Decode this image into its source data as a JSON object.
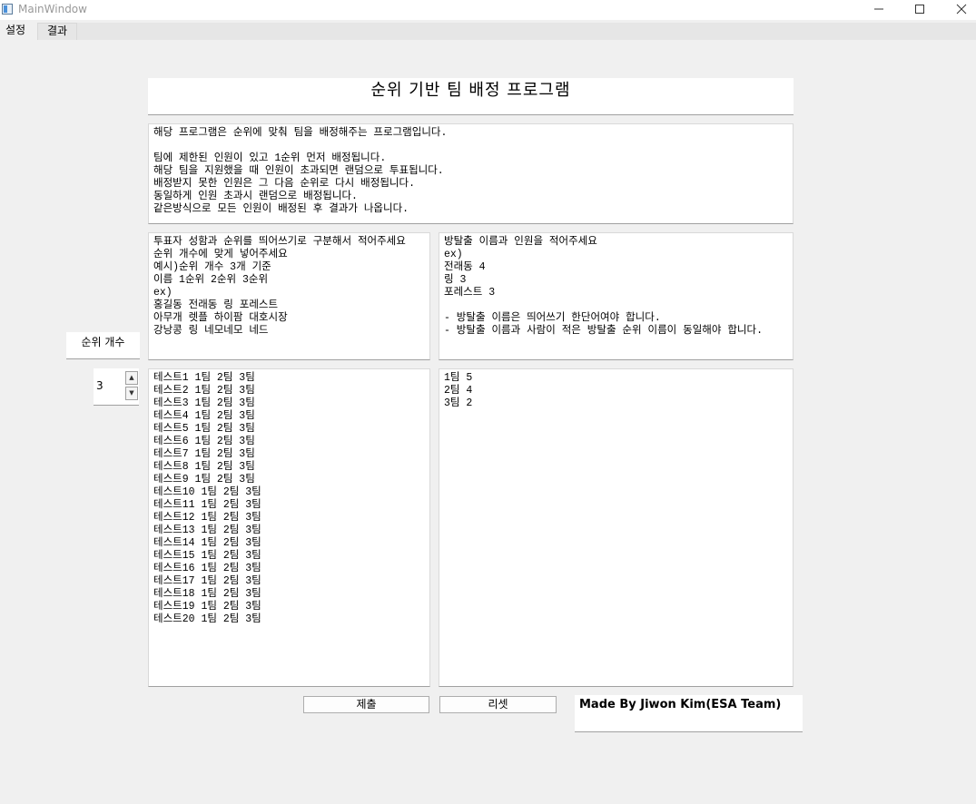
{
  "window": {
    "title": "MainWindow",
    "minimize_icon": "minimize-icon",
    "maximize_icon": "maximize-icon",
    "close_icon": "close-icon"
  },
  "tabs": [
    {
      "label": "설정",
      "active": true
    },
    {
      "label": "결과",
      "active": false
    }
  ],
  "header": {
    "title": "순위 기반 팀 배정 프로그램"
  },
  "description": "해당 프로그램은 순위에 맞춰 팀을 배정해주는 프로그램입니다.\n\n팀에 제한된 인원이 있고 1순위 먼저 배정됩니다.\n해당 팀을 지원했을 때 인원이 초과되면 랜덤으로 투표됩니다.\n배정받지 못한 인원은 그 다음 순위로 다시 배정됩니다.\n동일하게 인원 초과시 랜덤으로 배정됩니다.\n같은방식으로 모든 인원이 배정된 후 결과가 나옵니다.",
  "voter_instructions": "투표자 성함과 순위를 띄어쓰기로 구분해서 적어주세요\n순위 개수에 맞게 넣어주세요\n예시)순위 개수 3개 기준\n이름 1순위 2순위 3순위\nex)\n홍길동 전래동 링 포레스트\n아무개 렛플 하이팜 대호시장\n강낭콩 링 네모네모 네드",
  "team_instructions": "방탈출 이름과 인원을 적어주세요\nex)\n전래동 4\n링 3\n포레스트 3\n\n- 방탈출 이름은 띄어쓰기 한단어여야 합니다.\n- 방탈출 이름과 사람이 적은 방탈출 순위 이름이 동일해야 합니다.",
  "rank_count": {
    "label": "순위 개수",
    "value": "3",
    "up_icon": "arrow-up-icon",
    "down_icon": "arrow-down-icon"
  },
  "voter_input": "테스트1 1팀 2팀 3팀\n테스트2 1팀 2팀 3팀\n테스트3 1팀 2팀 3팀\n테스트4 1팀 2팀 3팀\n테스트5 1팀 2팀 3팀\n테스트6 1팀 2팀 3팀\n테스트7 1팀 2팀 3팀\n테스트8 1팀 2팀 3팀\n테스트9 1팀 2팀 3팀\n테스트10 1팀 2팀 3팀\n테스트11 1팀 2팀 3팀\n테스트12 1팀 2팀 3팀\n테스트13 1팀 2팀 3팀\n테스트14 1팀 2팀 3팀\n테스트15 1팀 2팀 3팀\n테스트16 1팀 2팀 3팀\n테스트17 1팀 2팀 3팀\n테스트18 1팀 2팀 3팀\n테스트19 1팀 2팀 3팀\n테스트20 1팀 2팀 3팀",
  "team_input": "1팀 5\n2팀 4\n3팀 2",
  "buttons": {
    "submit": "제출",
    "reset": "리셋"
  },
  "credit": "Made By Jiwon Kim(ESA Team)"
}
